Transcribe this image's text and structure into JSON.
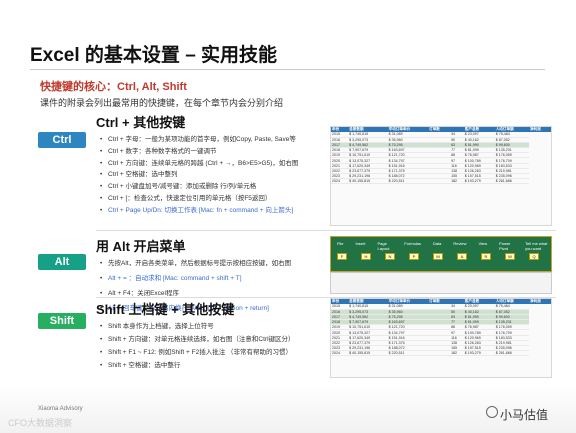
{
  "title": "Excel 的基本设置 – 实用技能",
  "subtitle": "快捷键的核心：Ctrl, Alt, Shift",
  "description": "课件的附录会列出最常用的快捷键，在每个章节内会分别介绍",
  "sections": {
    "ctrl": {
      "tag": "Ctrl",
      "heading": "Ctrl + 其他按键",
      "bullets": [
        "Ctrl + 字母：一般为某项功能的首字母，例如Copy, Paste, Save等",
        "Ctrl + 数字：各种数字格式的一键调节",
        "Ctrl + 方向键：连续单元格的跨越 (Ctrl + →，B6>E5>G5)，如右图",
        "Ctrl + 空格键：选中整列",
        "Ctrl + 小键盘加号/减号键：添加或删除 行/列/单元格",
        "Ctrl + [：检查公式，快速定位引用的单元格（按F5返回）",
        "Ctrl + Page Up/Dn: 切换工作表 [Mac: fn + command + 向上箭头]"
      ]
    },
    "alt": {
      "tag": "Alt",
      "heading": "用 Alt 开启菜单",
      "bullets": [
        "先按Alt，开启各类菜单，然后根据标号提示按相应按键，如右图",
        "Alt + = ：自动求和 [Mac: command + shift + T]",
        "Alt + F4：关闭Excel程序",
        "Alt + 回车键：单元格内换行 [Mac: ctrl + Option + return]"
      ]
    },
    "shift": {
      "tag": "Shift",
      "heading": "Shift 上档键 + 其他按键",
      "bullets": [
        "Shift 本身作为上档键，选择上位符号",
        "Shift + 方向键：对单元格连续选择，如右图（注意和Ctrl键区分）",
        "Shift + F1 ~ F12: 例如Shift + F2插入批注 （非常有帮助的习惯）",
        "Shift + 空格键：选中整行"
      ]
    }
  },
  "sheet": {
    "headers": [
      "年份",
      "总销售额",
      "平均订单单价",
      "订单数",
      "",
      "客户总数",
      "人均订单额",
      "净利润"
    ],
    "rows": [
      [
        "2015",
        "$ 1,740,815",
        "$ 31,089",
        "",
        "34",
        "$ 23,097",
        "$ 75,484"
      ],
      [
        "2016",
        "$ 3,295,073",
        "$ 35,960",
        "",
        "50",
        "$ 40,162",
        "$ 87,052"
      ],
      [
        "2017",
        "$ 4,749,562",
        "$ 75,295",
        "",
        "63",
        "$ 51,990",
        "$ 99,600"
      ],
      [
        "2018",
        "$ 7,907,679",
        "$ 163,697",
        "",
        "77",
        "$ 81,099",
        "$ 135,231"
      ],
      [
        "2019",
        "$ 10,751,610",
        "$ 121,720",
        "",
        "88",
        "$ 76,987",
        "$ 176,059"
      ],
      [
        "2020",
        "$ 13,075,327",
        "$ 134,797",
        "",
        "97",
        "$ 100,789",
        "$ 176,709"
      ],
      [
        "2021",
        "$ 17,620,349",
        "$ 151,916",
        "",
        "116",
        "$ 120,969",
        "$ 183,533"
      ],
      [
        "2022",
        "$ 23,677,379",
        "$ 171,375",
        "",
        "138",
        "$ 126,263",
        "$ 219,981"
      ],
      [
        "2023",
        "$ 29,231,196",
        "$ 188,072",
        "",
        "155",
        "$ 157,515",
        "$ 235,096"
      ],
      [
        "2024",
        "$ 40,155,815",
        "$ 220,511",
        "",
        "182",
        "$ 193,279",
        "$ 261,666"
      ]
    ]
  },
  "ribbon": {
    "tabs": [
      "File",
      "Insert",
      "Page Layout",
      "Formulas",
      "Data",
      "Review",
      "View",
      "Power Pivot",
      "Tell me what you want"
    ],
    "keytips": [
      "F",
      "H",
      "N",
      "P",
      "M",
      "A",
      "R",
      "W",
      "Q"
    ]
  },
  "footer": "Xiaoma Advisory",
  "watermark": "CFO大数据洞察",
  "brand": "小马估值",
  "colors": {
    "ctrl": "#2e86c1",
    "alt": "#16a085",
    "shift": "#27ae60",
    "header": "#2e75b6",
    "accent": "#c0392b"
  }
}
